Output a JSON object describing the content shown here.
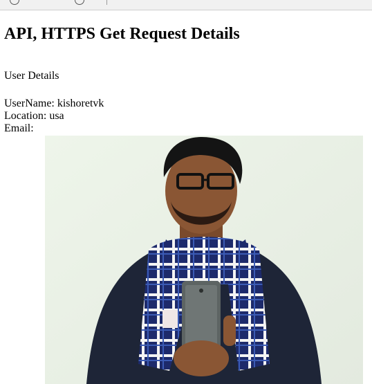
{
  "page": {
    "title": "API, HTTPS Get Request Details",
    "section_heading": "User Details"
  },
  "user": {
    "username_label": "UserName:",
    "username": "kishoretvk",
    "location_label": "Location:",
    "location": "usa",
    "email_label": "Email:",
    "email": ""
  },
  "avatar": {
    "description_icon": "profile-photo"
  }
}
